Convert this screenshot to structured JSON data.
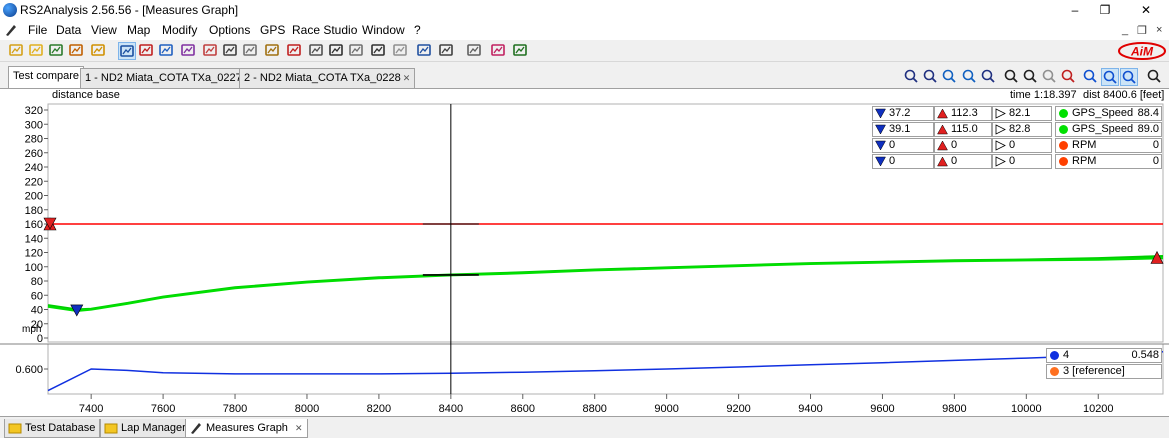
{
  "window": {
    "title": "RS2Analysis 2.56.56 - [Measures Graph]",
    "controls": [
      "–",
      "❐",
      "✕"
    ]
  },
  "menu": {
    "items": [
      "File",
      "Data",
      "View",
      "Map",
      "Modify",
      "Options",
      "GPS",
      "Race Studio",
      "Window",
      "?"
    ],
    "mdi_controls": [
      "_",
      "❐",
      "×"
    ]
  },
  "toolbar": {
    "icons": [
      "open-folder-icon",
      "open-icon",
      "download-icon",
      "import-icon",
      "filter-icon",
      "measures-graph-icon",
      "channel-icon",
      "split-icon",
      "xy-icon",
      "histogram-icon",
      "report-icon",
      "table-icon",
      "track-report-icon",
      "gauge-icon",
      "tools-icon",
      "math-icon",
      "shape-icon",
      "eraser-icon",
      "shoe-icon",
      "preview-icon",
      "print-icon",
      "calc-icon",
      "graph-icon",
      "screen-icon"
    ],
    "selected_index": 5,
    "logo_text": "AiM"
  },
  "tabs": [
    {
      "label": "Test compare",
      "closable": false,
      "active": true
    },
    {
      "label": "1 - ND2 Miata_COTA TXa_0227",
      "closable": true,
      "active": false
    },
    {
      "label": "2 - ND2 Miata_COTA TXa_0228",
      "closable": true,
      "active": false
    }
  ],
  "right_tools": [
    "zoom-3d-icon",
    "zoom-icon",
    "track-up-icon",
    "track-down-icon",
    "zoom-out-icon",
    "time-icon",
    "fit-icon",
    "shoe-icon",
    "triangle-icon",
    "layout-1-icon",
    "layout-2-icon",
    "layout-3-icon",
    "wrench-icon"
  ],
  "info": {
    "base": "distance base",
    "time": "time 1:18.397",
    "dist": "dist 8400.6 [feet]"
  },
  "legend": [
    {
      "min": "37.2",
      "max": "112.3",
      "cur": "82.1",
      "color": "#00e000",
      "name": "GPS_Speed",
      "value": "88.4"
    },
    {
      "min": "39.1",
      "max": "115.0",
      "cur": "82.8",
      "color": "#00e000",
      "name": "GPS_Speed",
      "value": "89.0"
    },
    {
      "min": "0",
      "max": "0",
      "cur": "0",
      "color": "#ff4000",
      "name": "RPM",
      "value": "0"
    },
    {
      "min": "0",
      "max": "0",
      "cur": "0",
      "color": "#ff4000",
      "name": "RPM",
      "value": "0"
    }
  ],
  "lower_legend": [
    {
      "color": "#1030e0",
      "name": "4",
      "value": "0.548"
    },
    {
      "color": "#ff7020",
      "name": "3 [reference]",
      "value": ""
    }
  ],
  "chart_data": [
    {
      "type": "line",
      "ylabel": "mph",
      "ylim": [
        0,
        320
      ],
      "yticks": [
        0,
        20,
        40,
        60,
        80,
        100,
        120,
        140,
        160,
        180,
        200,
        220,
        240,
        260,
        280,
        300,
        320
      ],
      "x": [
        7280,
        7360,
        7400,
        7500,
        7600,
        7800,
        8000,
        8200,
        8400,
        8600,
        8800,
        9000,
        9200,
        9400,
        9600,
        9800,
        10000,
        10200,
        10380
      ],
      "series": [
        {
          "name": "GPS_Speed",
          "color": "#00e000",
          "values": [
            44,
            38,
            40,
            48,
            57,
            70,
            78,
            84,
            88,
            91,
            95,
            98,
            101,
            104,
            106,
            108,
            109,
            110,
            112
          ]
        },
        {
          "name": "GPS_Speed",
          "color": "#00cc00",
          "values": [
            46,
            40,
            41,
            49,
            58,
            71,
            79,
            85,
            89,
            92,
            96,
            99,
            102,
            105,
            107,
            109,
            110,
            112,
            115
          ]
        },
        {
          "name": "RPM",
          "color": "#ff0000",
          "values": [
            160,
            160,
            160,
            160,
            160,
            160,
            160,
            160,
            160,
            160,
            160,
            160,
            160,
            160,
            160,
            160,
            160,
            160,
            160
          ]
        }
      ]
    },
    {
      "type": "line",
      "ylabel": "",
      "yticks": [
        0.6
      ],
      "ylim": [
        0.52,
        0.68
      ],
      "x": [
        7280,
        7400,
        7500,
        7600,
        7800,
        8000,
        8200,
        8400,
        8600,
        8800,
        9000,
        9200,
        9400,
        9600,
        9800,
        10000,
        10200,
        10380
      ],
      "series": [
        {
          "name": "4",
          "color": "#1030e0",
          "values": [
            0.525,
            0.6,
            0.595,
            0.587,
            0.583,
            0.583,
            0.583,
            0.585,
            0.589,
            0.594,
            0.6,
            0.607,
            0.615,
            0.622,
            0.63,
            0.638,
            0.647,
            0.66
          ]
        }
      ]
    }
  ],
  "xaxis": {
    "ticks": [
      7400,
      7600,
      7800,
      8000,
      8200,
      8400,
      8600,
      8800,
      9000,
      9200,
      9400,
      9600,
      9800,
      10000,
      10200
    ],
    "xlim": [
      7280,
      10380
    ],
    "cursor": 8400
  },
  "bottom_tabs": [
    {
      "label": "Test Database",
      "active": false
    },
    {
      "label": "Lap Manager",
      "active": false
    },
    {
      "label": "Measures Graph",
      "active": true,
      "closable": true
    }
  ]
}
